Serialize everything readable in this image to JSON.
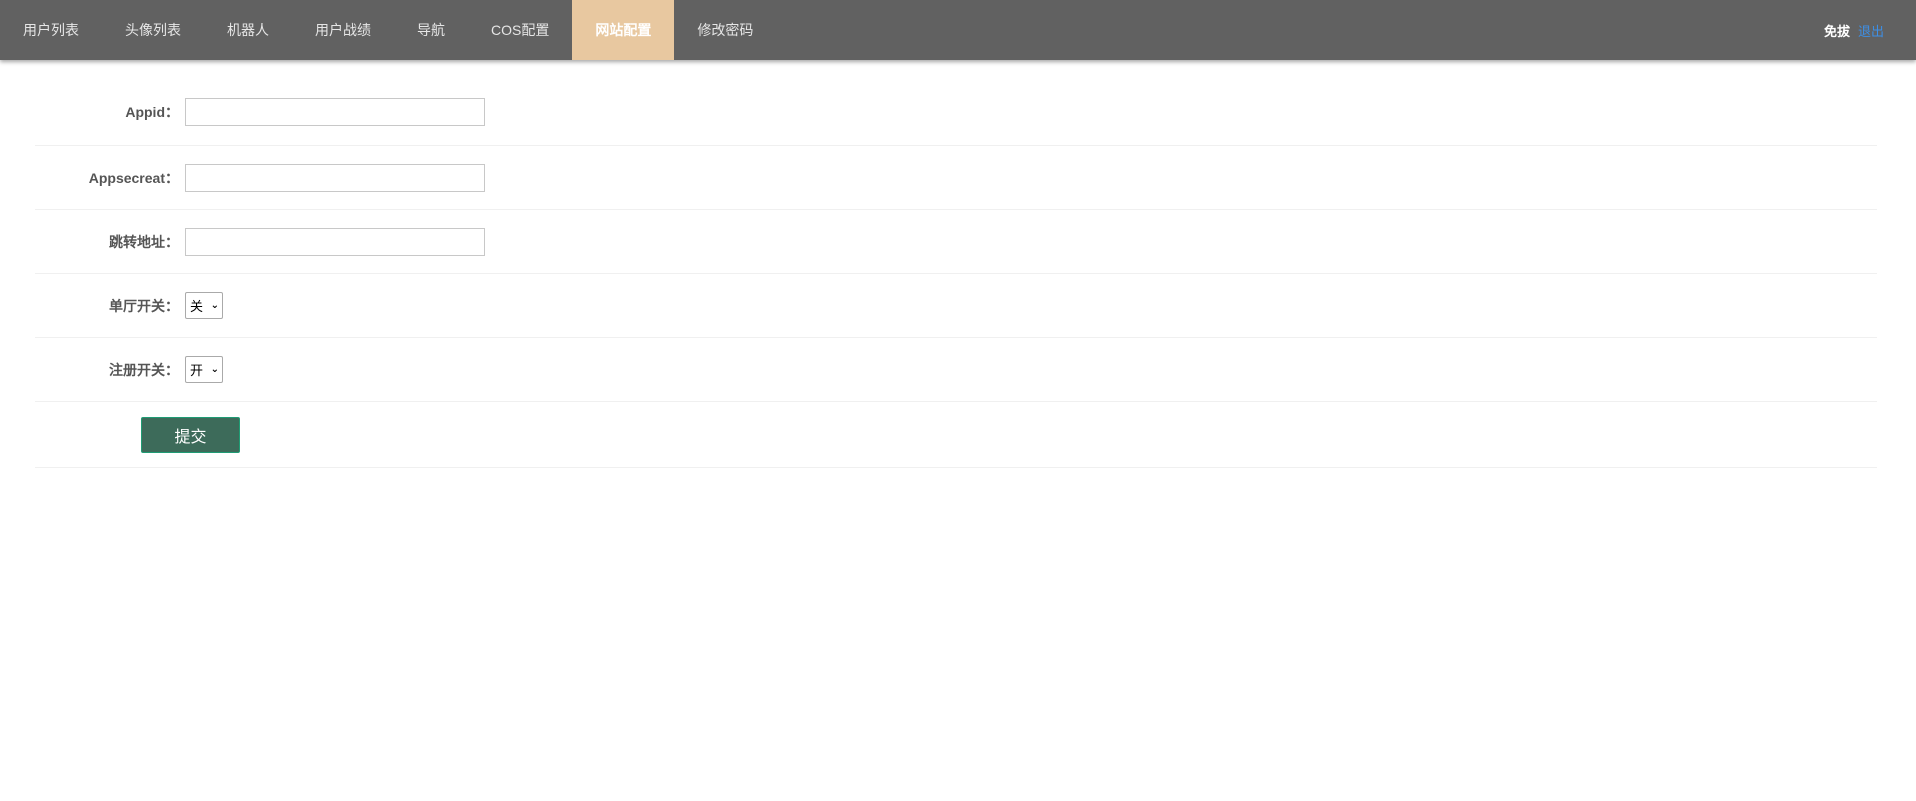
{
  "nav": {
    "items": [
      {
        "label": "用户列表",
        "active": false
      },
      {
        "label": "头像列表",
        "active": false
      },
      {
        "label": "机器人",
        "active": false
      },
      {
        "label": "用户战绩",
        "active": false
      },
      {
        "label": "导航",
        "active": false
      },
      {
        "label": "COS配置",
        "active": false
      },
      {
        "label": "网站配置",
        "active": true
      },
      {
        "label": "修改密码",
        "active": false
      }
    ],
    "active_color": "#e8c8a0",
    "bar_color": "#616161"
  },
  "user": {
    "name": "免拔",
    "logout_label": "退出"
  },
  "form": {
    "appid": {
      "label": "Appid：",
      "value": ""
    },
    "appsecret": {
      "label": "Appsecreat：",
      "value": ""
    },
    "redirect": {
      "label": "跳转地址：",
      "value": ""
    },
    "single_hall": {
      "label": "单厅开关：",
      "selected": "关"
    },
    "register": {
      "label": "注册开关：",
      "selected": "开"
    },
    "submit_label": "提交"
  }
}
